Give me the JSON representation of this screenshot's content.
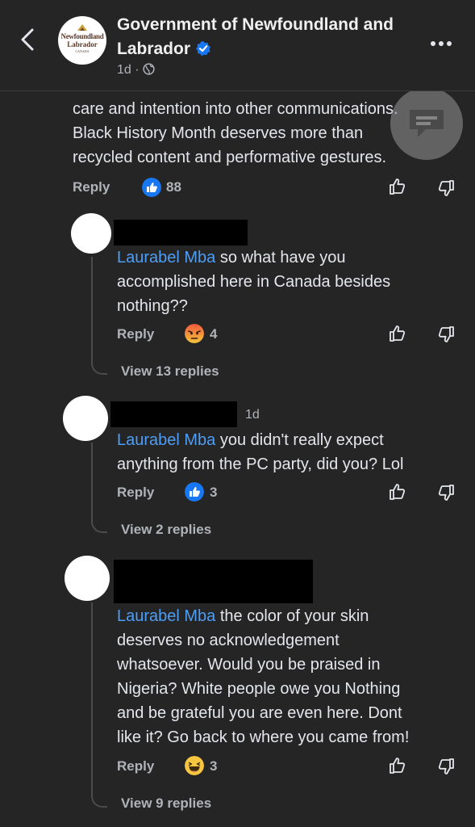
{
  "header": {
    "title": "Government of Newfoundland and Labrador",
    "time": "1d",
    "logo_line1": "Newfoundland",
    "logo_line2": "Labrador",
    "logo_line3": "CANADA",
    "back_icon": "chevron-left-icon",
    "more_icon": "more-horizontal-icon"
  },
  "top_comment": {
    "line1": "care and intention into other communications.",
    "line2": "Black History Month deserves more than",
    "line3": "recycled content and performative gestures.",
    "reply_label": "Reply",
    "reaction": "like",
    "reaction_count": "88"
  },
  "comments": [
    {
      "mention": "Laurabel Mba",
      "text1": " so what have you",
      "text2": "accomplished here in Canada besides",
      "text3": "nothing??",
      "reply_label": "Reply",
      "reaction": "angry",
      "reaction_count": "4",
      "view_replies": "View 13 replies"
    },
    {
      "time": "1d",
      "mention": "Laurabel Mba",
      "text1": " you didn't really expect",
      "text2": "anything from the PC party, did you? Lol",
      "reply_label": "Reply",
      "reaction": "like",
      "reaction_count": "3",
      "view_replies": "View 2 replies"
    },
    {
      "mention": "Laurabel Mba",
      "text1": " the  color of your skin",
      "text2": "deserves no acknowledgement",
      "text3": "whatsoever. Would you be praised in",
      "text4": "Nigeria? White people owe you Nothing",
      "text5": "and be grateful you are even here. Dont",
      "text6": "like it? Go back to where you came from!",
      "reply_label": "Reply",
      "reaction": "haha",
      "reaction_count": "3",
      "view_replies": "View 9 replies"
    }
  ],
  "colors": {
    "background": "#252526",
    "mention": "#4d9ef6",
    "like_blue": "#1877f2",
    "text": "#e4e6eb",
    "muted": "#b0b3b8"
  }
}
